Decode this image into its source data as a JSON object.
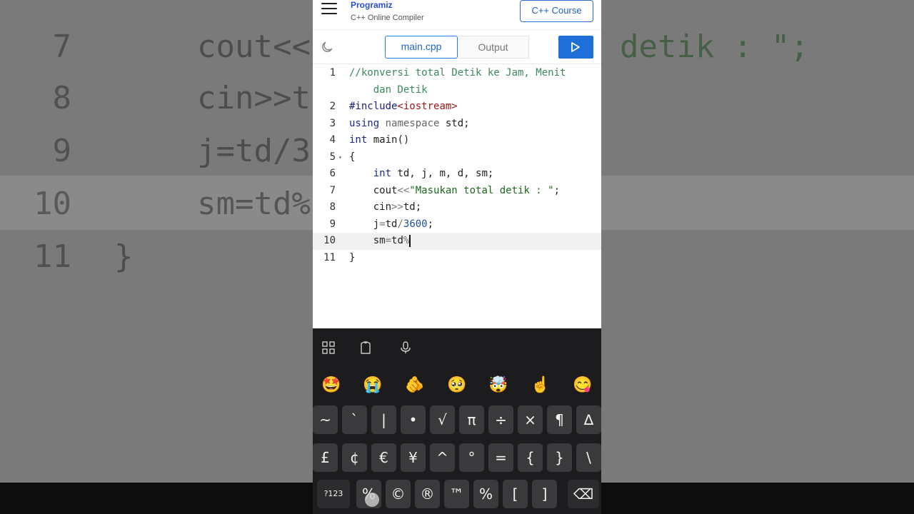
{
  "background_zoom": {
    "lines": [
      {
        "num": "7",
        "code": "cout<<",
        "tail": "detik : \";"
      },
      {
        "num": "8",
        "code": "cin>>t"
      },
      {
        "num": "9",
        "code": "j=td/3"
      },
      {
        "num": "10",
        "code": "sm=td%"
      },
      {
        "num": "11",
        "code": "}"
      }
    ]
  },
  "header": {
    "brand": "Programiz",
    "subtitle": "C++ Online Compiler",
    "course_button": "C++ Course"
  },
  "tabs": {
    "main": "main.cpp",
    "output": "Output"
  },
  "editor": {
    "lines": [
      {
        "num": "1",
        "parts": [
          {
            "t": "//konversi total Detik ke Jam, Menit",
            "c": "comment"
          }
        ]
      },
      {
        "num": "",
        "parts": [
          {
            "t": "    dan Detik",
            "c": "comment"
          }
        ]
      },
      {
        "num": "2",
        "parts": [
          {
            "t": "#include",
            "c": "pre"
          },
          {
            "t": "<iostream>",
            "c": "inc"
          }
        ]
      },
      {
        "num": "3",
        "parts": [
          {
            "t": "using",
            "c": "kw"
          },
          {
            "t": " namespace",
            "c": "ns"
          },
          {
            "t": " std;",
            "c": ""
          }
        ]
      },
      {
        "num": "4",
        "parts": [
          {
            "t": "int",
            "c": "kw"
          },
          {
            "t": " main()",
            "c": ""
          }
        ]
      },
      {
        "num": "5",
        "fold": true,
        "parts": [
          {
            "t": "{",
            "c": ""
          }
        ]
      },
      {
        "num": "6",
        "parts": [
          {
            "t": "    ",
            "c": ""
          },
          {
            "t": "int",
            "c": "kw"
          },
          {
            "t": " td, j, m, d, sm;",
            "c": ""
          }
        ]
      },
      {
        "num": "7",
        "parts": [
          {
            "t": "    cout",
            "c": ""
          },
          {
            "t": "<<",
            "c": "op"
          },
          {
            "t": "\"Masukan total detik : \"",
            "c": "str"
          },
          {
            "t": ";",
            "c": ""
          }
        ]
      },
      {
        "num": "8",
        "parts": [
          {
            "t": "    cin",
            "c": ""
          },
          {
            "t": ">>",
            "c": "op"
          },
          {
            "t": "td;",
            "c": ""
          }
        ]
      },
      {
        "num": "9",
        "parts": [
          {
            "t": "    j",
            "c": ""
          },
          {
            "t": "=",
            "c": "op"
          },
          {
            "t": "td",
            "c": ""
          },
          {
            "t": "/",
            "c": "op"
          },
          {
            "t": "3600",
            "c": "num"
          },
          {
            "t": ";",
            "c": ""
          }
        ]
      },
      {
        "num": "10",
        "active": true,
        "cursor": true,
        "parts": [
          {
            "t": "    sm",
            "c": ""
          },
          {
            "t": "=",
            "c": "op"
          },
          {
            "t": "td",
            "c": ""
          },
          {
            "t": "%",
            "c": "op"
          }
        ]
      },
      {
        "num": "11",
        "parts": [
          {
            "t": "}",
            "c": ""
          }
        ]
      }
    ]
  },
  "keyboard": {
    "emojis": [
      "🤩",
      "😭",
      "🫵",
      "🥺",
      "🤯",
      "☝️",
      "😋"
    ],
    "row1": [
      "~",
      "`",
      "|",
      "•",
      "√",
      "π",
      "÷",
      "×",
      "¶",
      "∆"
    ],
    "row2": [
      "£",
      "¢",
      "€",
      "¥",
      "^",
      "°",
      "=",
      "{",
      "}",
      "\\"
    ],
    "row3": [
      "?123",
      "%",
      "©",
      "®",
      "™",
      "%",
      "[",
      "]",
      "⌫"
    ]
  }
}
